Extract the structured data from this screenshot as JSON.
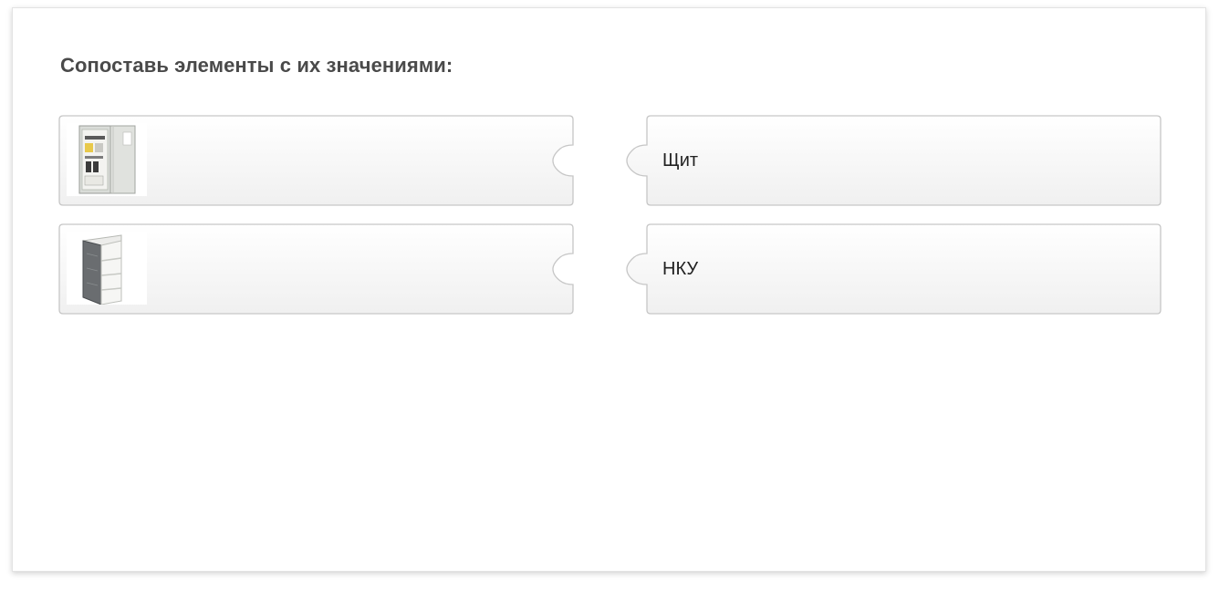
{
  "question": "Сопоставь элементы с их значениями:",
  "left_items": [
    {
      "image": "electrical-cabinet-open-icon"
    },
    {
      "image": "distribution-box-icon"
    }
  ],
  "right_items": [
    {
      "label": "Щит"
    },
    {
      "label": "НКУ"
    }
  ],
  "colors": {
    "tile_border": "#c8c8c8",
    "tile_top": "#ffffff",
    "tile_bottom": "#f1f1f1",
    "question_text": "#4a4a4a",
    "label_text": "#222222"
  }
}
